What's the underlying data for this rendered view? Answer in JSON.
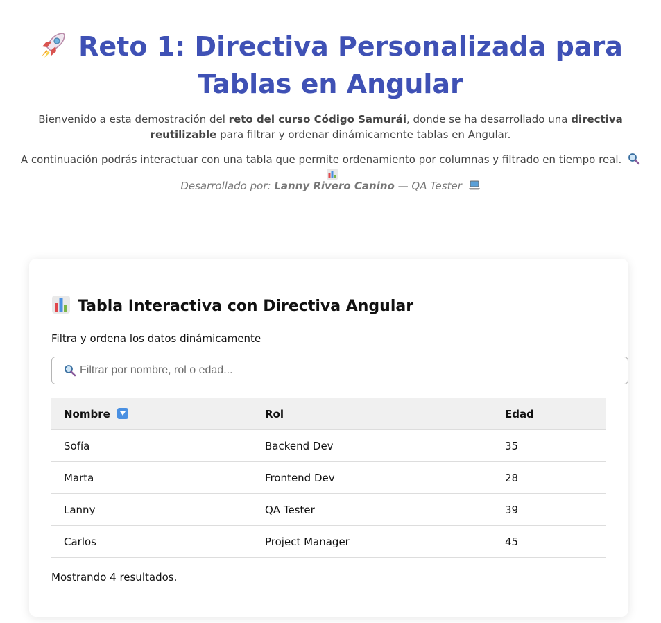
{
  "header": {
    "title": "Reto 1: Directiva Personalizada para Tablas en Angular",
    "intro_pre": "Bienvenido a esta demostración del ",
    "intro_bold1": "reto del curso Código Samurái",
    "intro_mid": ", donde se ha desarrollado una ",
    "intro_bold2": "directiva reutilizable",
    "intro_post": " para filtrar y ordenar dinámicamente tablas en Angular.",
    "intro_line2": "A continuación podrás interactuar con una tabla que permite ordenamiento por columnas y filtrado en tiempo real.",
    "author_prefix": "Desarrollado por: ",
    "author_name": "Lanny Rivero Canino",
    "author_suffix": " — QA Tester"
  },
  "card": {
    "title": "Tabla Interactiva con Directiva Angular",
    "subtitle": "Filtra y ordena los datos dinámicamente",
    "search_placeholder": "Filtrar por nombre, rol o edad...",
    "search_value": "",
    "columns": [
      "Nombre",
      "Rol",
      "Edad"
    ],
    "rows": [
      {
        "nombre": "Sofía",
        "rol": "Backend Dev",
        "edad": "35"
      },
      {
        "nombre": "Marta",
        "rol": "Frontend Dev",
        "edad": "28"
      },
      {
        "nombre": "Lanny",
        "rol": "QA Tester",
        "edad": "39"
      },
      {
        "nombre": "Carlos",
        "rol": "Project Manager",
        "edad": "45"
      }
    ],
    "result_text": "Mostrando 4 resultados."
  },
  "icons": {
    "title": "rocket-icon",
    "intro_line2": [
      "magnifier-icon",
      "bar-chart-icon"
    ],
    "author": "laptop-icon",
    "card_title": "bar-chart-icon",
    "search": "magnifier-icon",
    "sort": "sort-down-icon"
  },
  "colors": {
    "title": "#3f51b5",
    "header_row_bg": "#f0f0f0",
    "sort_badge": "#4a90e2"
  }
}
